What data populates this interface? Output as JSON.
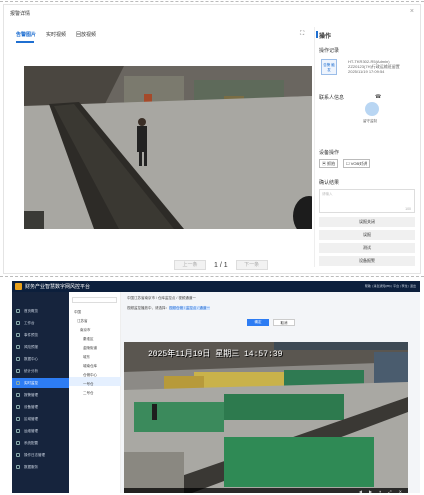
{
  "dialog": {
    "title": "报警详情",
    "close_label": "×",
    "tabs": [
      "告警图片",
      "实时视频",
      "回放视频"
    ],
    "fullscreen_icon": "⛶",
    "pager": {
      "prev": "上一条",
      "page": "1 / 1",
      "next": "下一条"
    }
  },
  "panel": {
    "header": "操作",
    "log_title": "操作记录",
    "log_badge": "告警\n触发",
    "log_lines": [
      "HT-TKR302-R5(Admin)",
      "ZZ20123(7H)行政运输班留置",
      "2025/11/19 17:09:54"
    ],
    "contact_title": "联系人信息",
    "avatar_label": "留守监制",
    "device_title": "设备操作",
    "device_buttons": [
      "▣ 抓拍",
      "☐ VOB对讲"
    ],
    "confirm_title": "确认结果",
    "textarea_placeholder": "请输入",
    "textarea_count": "100",
    "actions": [
      "误报关闭",
      "误报",
      "测试",
      "设备报警"
    ]
  },
  "app": {
    "title": "财务产业智慧数字网风控平台",
    "top_right": "帮助 | 消息通知(88) | 平台 | 李龙 | 退出",
    "sidebar": [
      "首页概览",
      "工作台",
      "事件预览",
      "风险预报",
      "数据中心",
      "统计分析",
      "实时监控",
      "报警管理",
      "设备管理",
      "区域管理",
      "运维管理",
      "系统配置",
      "操作日志管理",
      "数据服务"
    ],
    "sidebar_active_index": 6,
    "tree": [
      "中国",
      "江苏省",
      "南京市",
      "秦淮区",
      "金陵街道",
      "城东",
      "城南仓库",
      "仓储中心",
      "一号仓",
      "二号仓"
    ],
    "breadcrumb": "中国江苏省南京市 / 仓库监控点 / 视频通道一",
    "hint_prefix": "视频监控播放中，请选择：",
    "hint_highlight": "视频仓储 / 监控点 / 通道一",
    "btn_primary": "确定",
    "btn_secondary": "取消",
    "osd": "2025年11月19日 星期三 14:57:39",
    "ctrl_icons": "◀ ▶ ⏸ ⤢ ✕"
  }
}
